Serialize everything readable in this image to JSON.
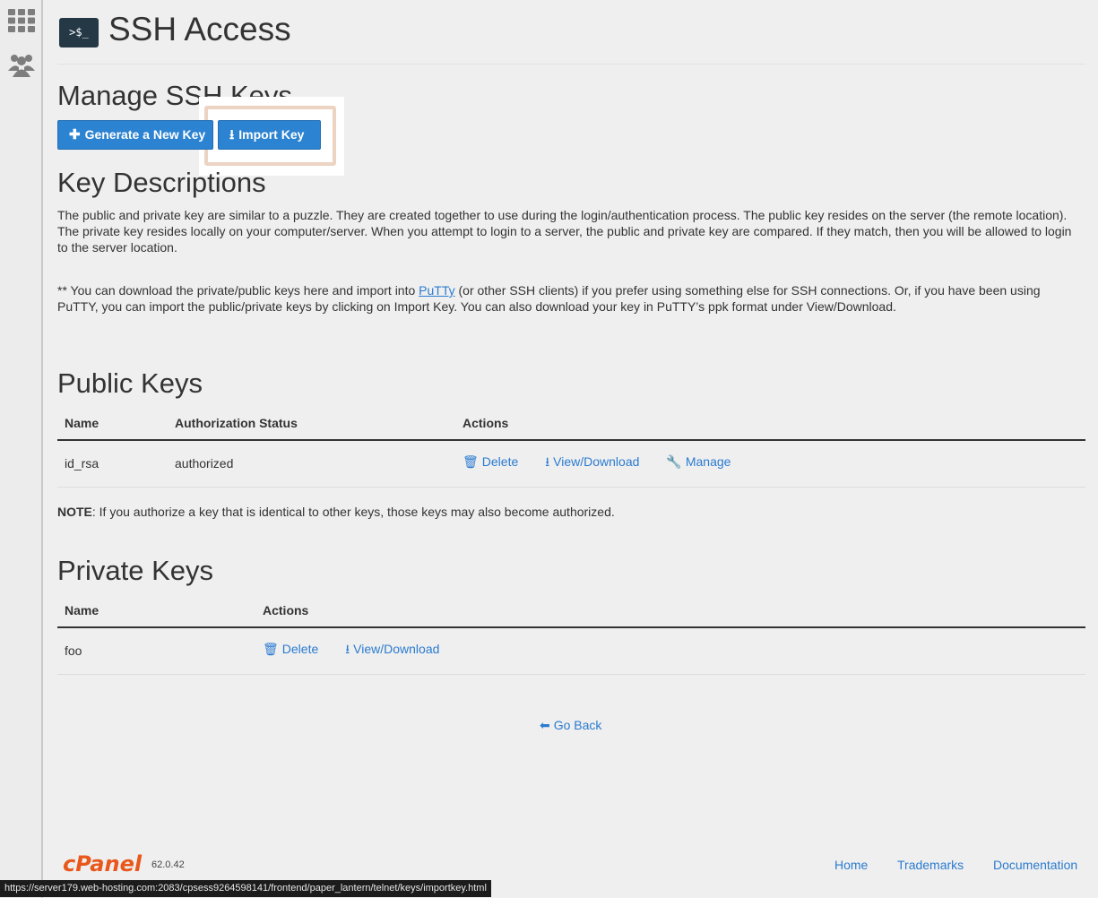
{
  "sidebar": {
    "icons": [
      {
        "name": "apps-grid-icon"
      },
      {
        "name": "users-icon"
      }
    ]
  },
  "header": {
    "icon_text": ">$_",
    "title": "SSH Access"
  },
  "manage": {
    "heading": "Manage SSH Keys",
    "generate_label": "Generate a New Key",
    "import_label": "Import Key"
  },
  "descriptions": {
    "heading": "Key Descriptions",
    "paragraph1": "The public and private key are similar to a puzzle. They are created together to use during the login/authentication process. The public key resides on the server (the remote location). The private key resides locally on your computer/server. When you attempt to login to a server, the public and private key are compared. If they match, then you will be allowed to login to the server location.",
    "p2_before": "** You can download the private/public keys here and import into ",
    "p2_link": "PuTTy",
    "p2_after": " (or other SSH clients) if you prefer using something else for SSH connections. Or, if you have been using PuTTY, you can import the public/private keys by clicking on Import Key. You can also download your key in PuTTY’s ppk format under View/Download."
  },
  "public_keys": {
    "heading": "Public Keys",
    "columns": [
      "Name",
      "Authorization Status",
      "Actions"
    ],
    "rows": [
      {
        "name": "id_rsa",
        "status": "authorized",
        "actions": [
          "Delete",
          "View/Download",
          "Manage"
        ]
      }
    ],
    "note_label": "NOTE",
    "note_text": ": If you authorize a key that is identical to other keys, those keys may also become authorized."
  },
  "private_keys": {
    "heading": "Private Keys",
    "columns": [
      "Name",
      "Actions"
    ],
    "rows": [
      {
        "name": "foo",
        "actions": [
          "Delete",
          "View/Download"
        ]
      }
    ]
  },
  "go_back": "Go Back",
  "footer": {
    "logo": "cPanel",
    "version": "62.0.42",
    "links": [
      "Home",
      "Trademarks",
      "Documentation"
    ]
  },
  "status_url": "https://server179.web-hosting.com:2083/cpsess9264598141/frontend/paper_lantern/telnet/keys/importkey.html",
  "colors": {
    "accent": "#2c83d1",
    "link": "#2b7bd0",
    "brand": "#e8581c",
    "highlight": "#ecd3c2"
  }
}
